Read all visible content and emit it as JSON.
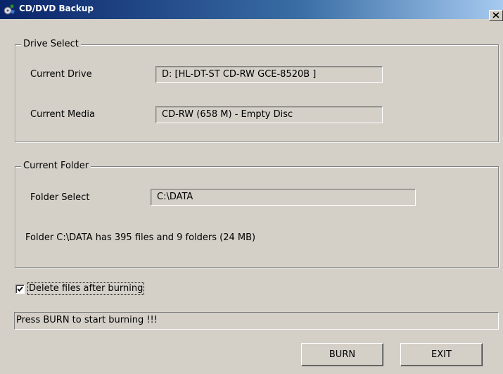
{
  "window": {
    "title": "CD/DVD Backup",
    "app_icon": "cd-burn-app-icon",
    "close_icon": "close-icon"
  },
  "drive_select": {
    "legend": "Drive Select",
    "current_drive_label": "Current Drive",
    "current_drive_value": "D: [HL-DT-ST CD-RW GCE-8520B ]",
    "current_media_label": "Current Media",
    "current_media_value": "CD-RW (658 M) -  Empty Disc"
  },
  "current_folder": {
    "legend": "Current Folder",
    "folder_select_label": "Folder Select",
    "folder_select_value": "C:\\DATA",
    "folder_info": "Folder C:\\DATA has 395 files and 9 folders (24 MB)"
  },
  "options": {
    "delete_after_burn_label": "Delete files after burning",
    "delete_after_burn_checked": true
  },
  "status": {
    "message": "Press BURN to start burning !!!"
  },
  "buttons": {
    "burn": "BURN",
    "exit": "EXIT"
  }
}
